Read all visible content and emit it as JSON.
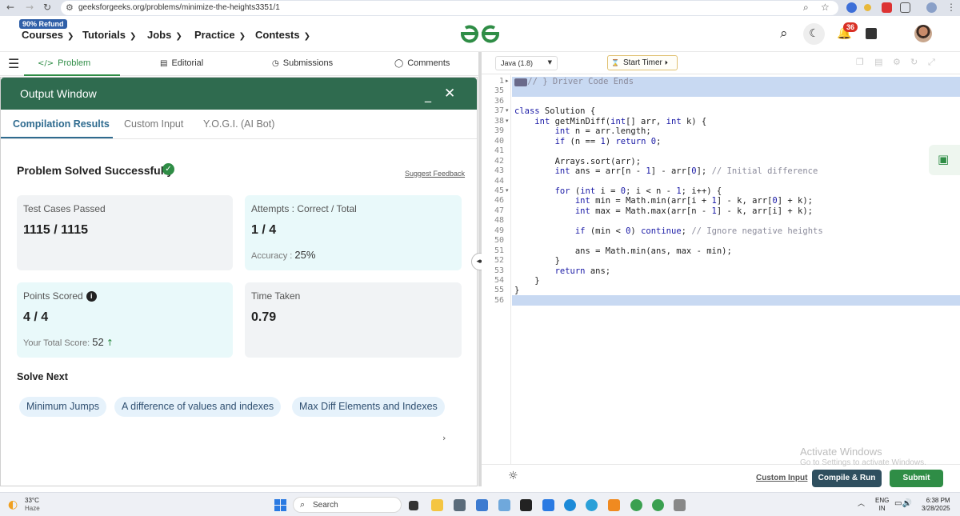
{
  "browser": {
    "url": "geeksforgeeks.org/problems/minimize-the-heights3351/1"
  },
  "header": {
    "refund_badge": "90% Refund",
    "nav": [
      "Courses",
      "Tutorials",
      "Jobs",
      "Practice",
      "Contests"
    ],
    "notification_count": "36"
  },
  "problem_tabs": [
    "Problem",
    "Editorial",
    "Submissions",
    "Comments"
  ],
  "output_window": {
    "title": "Output Window",
    "tabs": [
      "Compilation Results",
      "Custom Input",
      "Y.O.G.I. (AI Bot)"
    ],
    "status": "Problem Solved Successfully",
    "feedback_link": "Suggest Feedback",
    "test_cases": {
      "label": "Test Cases Passed",
      "value": "1115 / 1115"
    },
    "attempts": {
      "label": "Attempts : Correct / Total",
      "value": "1 / 4",
      "accuracy_label": "Accuracy :",
      "accuracy_value": "25%"
    },
    "points": {
      "label": "Points Scored",
      "value": "4 / 4",
      "total_label": "Your Total Score:",
      "total_value": "52"
    },
    "time": {
      "label": "Time Taken",
      "value": "0.79"
    },
    "solve_next_title": "Solve Next",
    "solve_next": [
      "Minimum Jumps",
      "A difference of values and indexes",
      "Max Diff Elements and Indexes"
    ]
  },
  "editor": {
    "language": "Java (1.8)",
    "timer_label": "Start Timer",
    "line_numbers": [
      "1",
      "35",
      "36",
      "37",
      "38",
      "39",
      "40",
      "41",
      "42",
      "43",
      "44",
      "45",
      "46",
      "47",
      "48",
      "49",
      "50",
      "51",
      "52",
      "53",
      "54",
      "55",
      "56"
    ],
    "lines": [
      "// } Driver Code Ends",
      "",
      "",
      "class Solution {",
      "    int getMinDiff(int[] arr, int k) {",
      "        int n = arr.length;",
      "        if (n == 1) return 0;",
      "",
      "        Arrays.sort(arr);",
      "        int ans = arr[n - 1] - arr[0]; // Initial difference",
      "",
      "        for (int i = 0; i < n - 1; i++) {",
      "            int min = Math.min(arr[i + 1] - k, arr[0] + k);",
      "            int max = Math.max(arr[n - 1] - k, arr[i] + k);",
      "",
      "            if (min < 0) continue; // Ignore negative heights",
      "",
      "            ans = Math.min(ans, max - min);",
      "        }",
      "        return ans;",
      "    }",
      "}",
      ""
    ],
    "custom_input_label": "Custom Input",
    "compile_label": "Compile & Run",
    "submit_label": "Submit"
  },
  "watermark": {
    "line1": "Activate Windows",
    "line2": "Go to Settings to activate Windows."
  },
  "taskbar": {
    "temperature": "33°C",
    "weather": "Haze",
    "search_placeholder": "Search",
    "lang_line1": "ENG",
    "lang_line2": "IN",
    "time": "6:38 PM",
    "date": "3/28/2025"
  },
  "colors": {
    "brand_green": "#2f8d46",
    "output_header": "#2f6b4f",
    "selection": "#c8d9f2"
  }
}
